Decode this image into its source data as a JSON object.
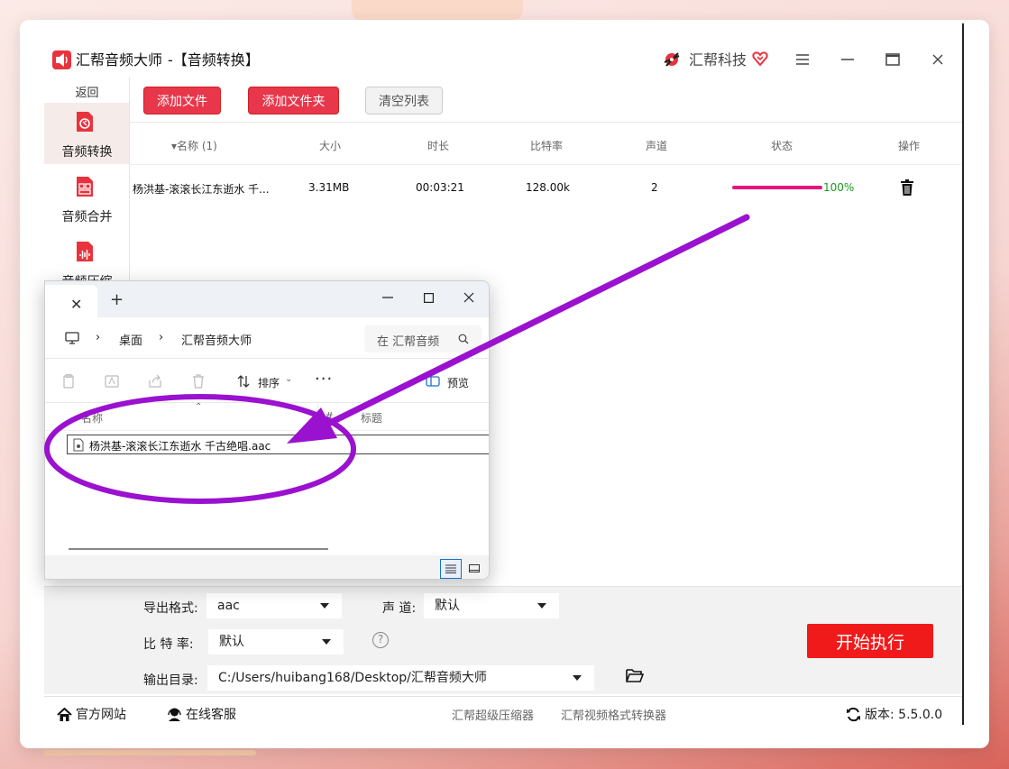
{
  "app": {
    "title": "汇帮音频大师",
    "subtitle": "-【音频转换】",
    "brand": "汇帮科技",
    "colors": {
      "accent": "#e8364a",
      "start": "#f01a1a",
      "progress": "#e6177a",
      "success": "#1a9a1a"
    }
  },
  "nav": {
    "back": "返回",
    "items": [
      {
        "label": "音频转换",
        "icon": "audio-convert-icon",
        "active": true
      },
      {
        "label": "音频合并",
        "icon": "audio-merge-icon",
        "active": false
      },
      {
        "label": "音频压缩",
        "icon": "audio-compress-icon",
        "active": false
      }
    ]
  },
  "toolbar": {
    "add_file": "添加文件",
    "add_folder": "添加文件夹",
    "clear_list": "清空列表"
  },
  "table": {
    "headers": {
      "name": "▾名称 (1)",
      "size": "大小",
      "duration": "时长",
      "bitrate": "比特率",
      "channels": "声道",
      "status": "状态",
      "action": "操作"
    },
    "rows": [
      {
        "name": "杨洪基-滚滚长江东逝水  千...",
        "size": "3.31MB",
        "duration": "00:03:21",
        "bitrate": "128.00k",
        "channels": "2",
        "progress": 1.0,
        "progress_text": "100%"
      }
    ]
  },
  "settings": {
    "format_label": "导出格式:",
    "format_value": "aac",
    "channel_label": "声 道:",
    "channel_value": "默认",
    "bitrate_label": "比 特 率:",
    "bitrate_value": "默认",
    "help": "?",
    "output_label": "输出目录:",
    "output_value": "C:/Users/huibang168/Desktop/汇帮音频大师",
    "start": "开始执行"
  },
  "footer": {
    "website": "官方网站",
    "support": "在线客服",
    "link1": "汇帮超级压缩器",
    "link2": "汇帮视频格式转换器",
    "version": "版本: 5.5.0.0"
  },
  "explorer": {
    "close_tab": "✕",
    "new_tab": "+",
    "crumb_desktop": "桌面",
    "crumb_folder": "汇帮音频大师",
    "search_placeholder": "在 汇帮音频",
    "sort": "排序",
    "more": "···",
    "preview": "预览",
    "col_name": "名称",
    "col_num": "#",
    "col_title": "标题",
    "file_name": "杨洪基-滚滚长江东逝水  千古绝唱.aac"
  }
}
